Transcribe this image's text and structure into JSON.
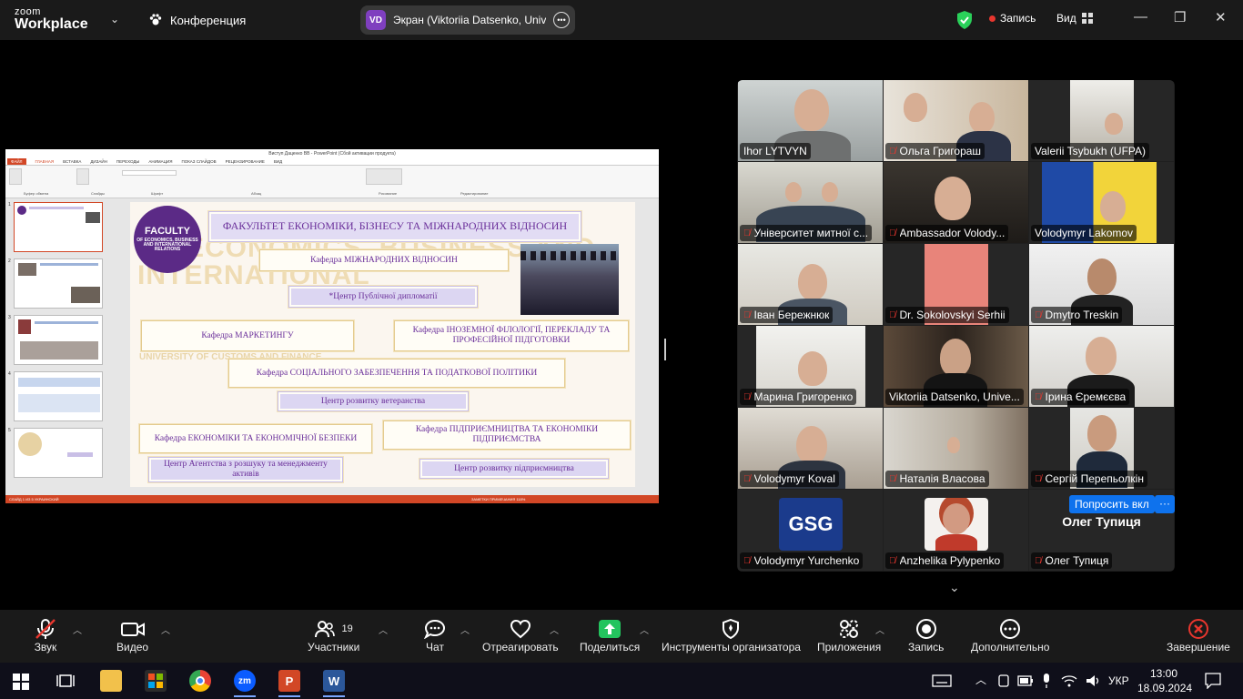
{
  "topbar": {
    "logo_line1": "zoom",
    "logo_line2": "Workplace",
    "meeting_label": "Конференция",
    "screen_share": {
      "initials": "VD",
      "text": "Экран (Viktoriia Datsenko, Unive"
    },
    "recording_label": "Запись",
    "view_label": "Вид"
  },
  "slide_app": {
    "title": "Виступ Даценко ВВ - PowerPoint (Сбой активации продукта)",
    "tabs": [
      "ФАЙЛ",
      "ГЛАВНАЯ",
      "ВСТАВКА",
      "ДИЗАЙН",
      "ПЕРЕХОДЫ",
      "АНИМАЦИЯ",
      "ПОКАЗ СЛАЙДОВ",
      "РЕЦЕНЗИРОВАНИЕ",
      "ВИД"
    ],
    "ribbon_groups": [
      "Буфер обмена",
      "Слайды",
      "Шрифт",
      "Абзац",
      "Рисование",
      "Редактирование"
    ],
    "thumb_numbers": [
      "1",
      "2",
      "3",
      "4",
      "5"
    ],
    "status_left": "СЛАЙД 1 ИЗ 5   УКРАИНСКИЙ",
    "status_right": "ЗАМЕТКИ   ПРИМЕЧАНИЯ   118%"
  },
  "slide": {
    "logo_text": "FACULTY",
    "logo_sub": "OF ECONOMICS, BUSINESS AND INTERNATIONAL RELATIONS",
    "watermark": "OF ECONOMICS, BUSINESS AND INTERNATIONAL",
    "watermark2": "UNIVERSITY OF CUSTOMS AND FINANCE",
    "title": "ФАКУЛЬТЕТ ЕКОНОМІКИ, БІЗНЕСУ ТА МІЖНАРОДНИХ ВІДНОСИН",
    "boxes": {
      "mv": "Кафедра МІЖНАРОДНИХ ВІДНОСИН",
      "cpd": "*Центр Публічної дипломатії",
      "mkt": "Кафедра МАРКЕТИНГУ",
      "ifp": "Кафедра ІНОЗЕМНОЇ ФІЛОЛОГІЇ, ПЕРЕКЛАДУ ТА ПРОФЕСІЙНОЇ ПІДГОТОВКИ",
      "szp": "Кафедра СОЦІАЛЬНОГО ЗАБЕЗПЕЧЕННЯ ТА ПОДАТКОВОЇ ПОЛІТИКИ",
      "crv": "Центр розвитку ветеранства",
      "eeb": "Кафедра ЕКОНОМІКИ ТА ЕКОНОМІЧНОЇ БЕЗПЕКИ",
      "pe": "Кафедра ПІДПРИЄМНИЦТВА ТА ЕКОНОМІКИ ПІДПРИЄМСТВА",
      "ar": "Центр Агентства з розшуку та менеджменту активів",
      "crp": "Центр розвитку підприємництва"
    }
  },
  "participants": [
    {
      "name": "Ihor LYTVYN",
      "muted": false
    },
    {
      "name": "Ольга Григораш",
      "muted": true
    },
    {
      "name": "Valerii Tsybukh  (UFPA)",
      "muted": false
    },
    {
      "name": "Університет митної с...",
      "muted": true
    },
    {
      "name": "Ambassador Volody...",
      "muted": true
    },
    {
      "name": "Volodymyr Lakomov",
      "muted": false
    },
    {
      "name": "Іван Бережнюк",
      "muted": true
    },
    {
      "name": "Dr. Sokolovskyi Serhii",
      "muted": true
    },
    {
      "name": "Dmytro Treskin",
      "muted": true
    },
    {
      "name": "Марина Григоренко",
      "muted": true
    },
    {
      "name": "Viktoriia Datsenko, Unive...",
      "muted": false
    },
    {
      "name": "Ірина Єремєєва",
      "muted": true
    },
    {
      "name": "Volodymyr Koval",
      "muted": true
    },
    {
      "name": "Наталія Власова",
      "muted": true
    },
    {
      "name": "Сергій Перепьолкін",
      "muted": true
    },
    {
      "name": "Volodymyr Yurchenko",
      "muted": true
    },
    {
      "name": "Anzhelika Pylypenko",
      "muted": true
    },
    {
      "name": "Олег Тупиця",
      "muted": true
    }
  ],
  "gallery": {
    "big_name": "Олег Тупиця",
    "ask_button": "Попросить вкл",
    "more_button": "···",
    "avatar_logo": "GSG"
  },
  "toolbar": {
    "audio": "Звук",
    "video": "Видео",
    "participants": "Участники",
    "participants_count": "19",
    "chat": "Чат",
    "react": "Отреагировать",
    "share": "Поделиться",
    "host_tools": "Инструменты организатора",
    "apps": "Приложения",
    "record": "Запись",
    "more": "Дополнительно",
    "end": "Завершение"
  },
  "taskbar": {
    "lang": "УКР",
    "time": "13:00",
    "date": "18.09.2024"
  },
  "colors": {
    "accent_green": "#2ad15a",
    "zoom_blue": "#0e72ed",
    "record_red": "#e8362e",
    "ppt_orange": "#d24726",
    "faculty_purple": "#5b2a86"
  }
}
